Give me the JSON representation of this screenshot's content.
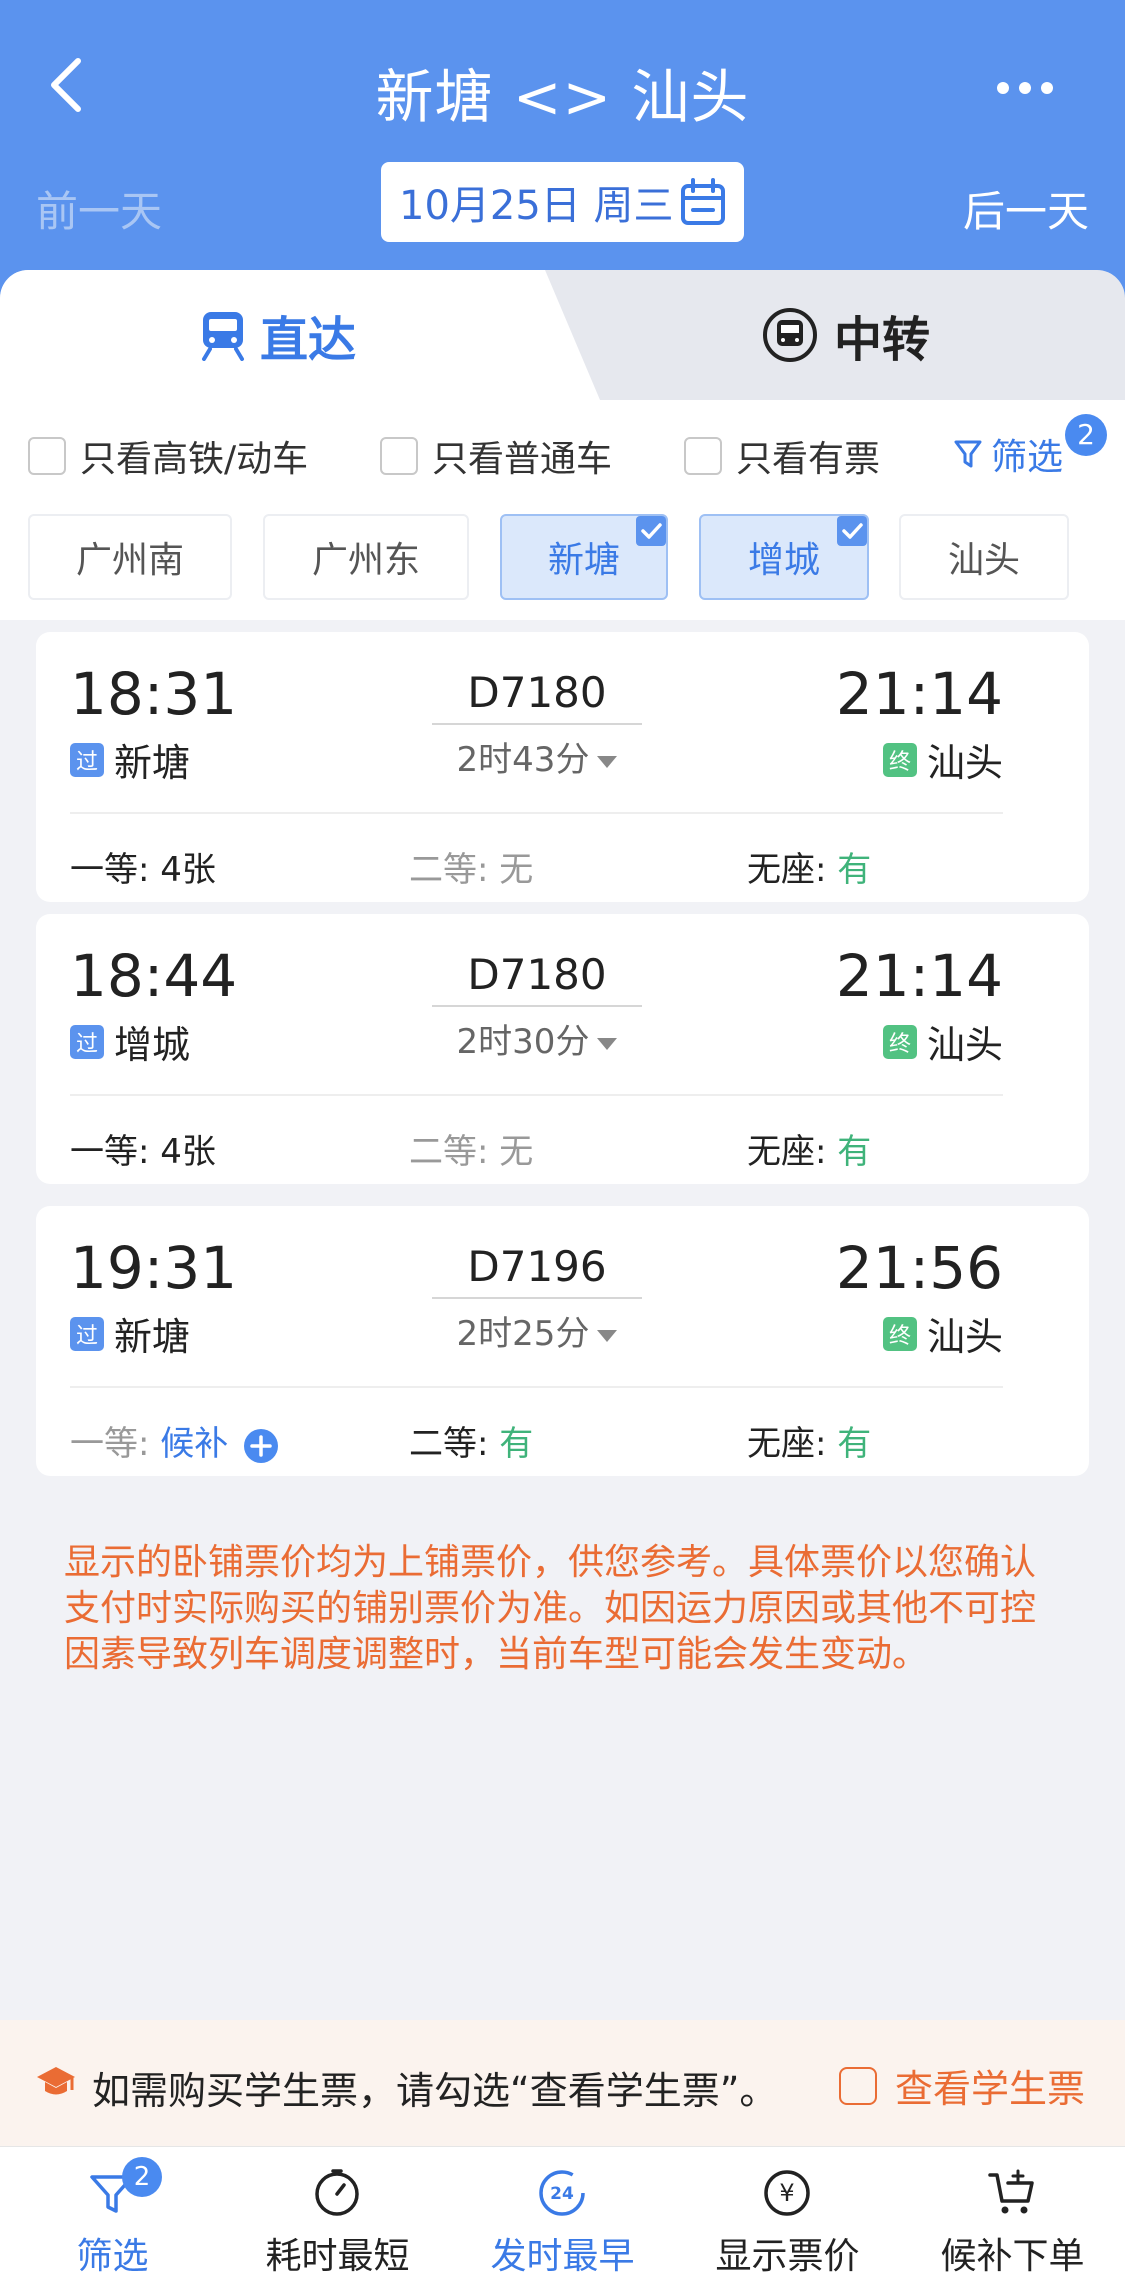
{
  "header": {
    "title": "新塘 <> 汕头",
    "prev_day": "前一天",
    "next_day": "后一天",
    "date": "10月25日 周三"
  },
  "tabs": [
    {
      "label": "直达",
      "active": true
    },
    {
      "label": "中转",
      "active": false
    }
  ],
  "filters": {
    "only_high_speed": "只看高铁/动车",
    "only_normal": "只看普通车",
    "only_available": "只看有票",
    "filter_label": "筛选",
    "filter_count": "2"
  },
  "stations": [
    {
      "name": "广州南",
      "selected": false
    },
    {
      "name": "广州东",
      "selected": false
    },
    {
      "name": "新塘",
      "selected": true
    },
    {
      "name": "增城",
      "selected": true
    },
    {
      "name": "汕头",
      "selected": false
    }
  ],
  "trains": [
    {
      "dep_time": "18:31",
      "dep_tag": "过",
      "dep_station": "新塘",
      "train_no": "D7180",
      "duration": "2时43分",
      "arr_time": "21:14",
      "arr_tag": "终",
      "arr_station": "汕头",
      "seats": [
        {
          "label": "一等: ",
          "value": "4张"
        },
        {
          "label": "二等: ",
          "value": "无"
        },
        {
          "label": "无座: ",
          "value": "有"
        }
      ]
    },
    {
      "dep_time": "18:44",
      "dep_tag": "过",
      "dep_station": "增城",
      "train_no": "D7180",
      "duration": "2时30分",
      "arr_time": "21:14",
      "arr_tag": "终",
      "arr_station": "汕头",
      "seats": [
        {
          "label": "一等: ",
          "value": "4张"
        },
        {
          "label": "二等: ",
          "value": "无"
        },
        {
          "label": "无座: ",
          "value": "有"
        }
      ]
    },
    {
      "dep_time": "19:31",
      "dep_tag": "过",
      "dep_station": "新塘",
      "train_no": "D7196",
      "duration": "2时25分",
      "arr_time": "21:56",
      "arr_tag": "终",
      "arr_station": "汕头",
      "seats": [
        {
          "label": "一等: ",
          "value": "候补"
        },
        {
          "label": "二等: ",
          "value": "有"
        },
        {
          "label": "无座: ",
          "value": "有"
        }
      ]
    }
  ],
  "notice": "显示的卧铺票价均为上铺票价，供您参考。具体票价以您确认支付时实际购买的铺别票价为准。如因运力原因或其他不可控因素导致列车调度调整时，当前车型可能会发生变动。",
  "student": {
    "text": "如需购买学生票，请勾选“查看学生票”。",
    "check_label": "查看学生票"
  },
  "bottom_nav": [
    {
      "label": "筛选",
      "badge": "2",
      "icon": "filter-icon"
    },
    {
      "label": "耗时最短",
      "icon": "timer-icon"
    },
    {
      "label": "发时最早",
      "icon": "clock-24-icon",
      "icon_text": "24"
    },
    {
      "label": "显示票价",
      "icon": "yuan-icon",
      "icon_text": "¥"
    },
    {
      "label": "候补下单",
      "icon": "cart-add-icon"
    }
  ],
  "colors": {
    "header_bg": "#5b93ee",
    "accent_blue": "#3a7ae6",
    "available_green": "#3fb37a",
    "notice_orange": "#ea6c34"
  }
}
